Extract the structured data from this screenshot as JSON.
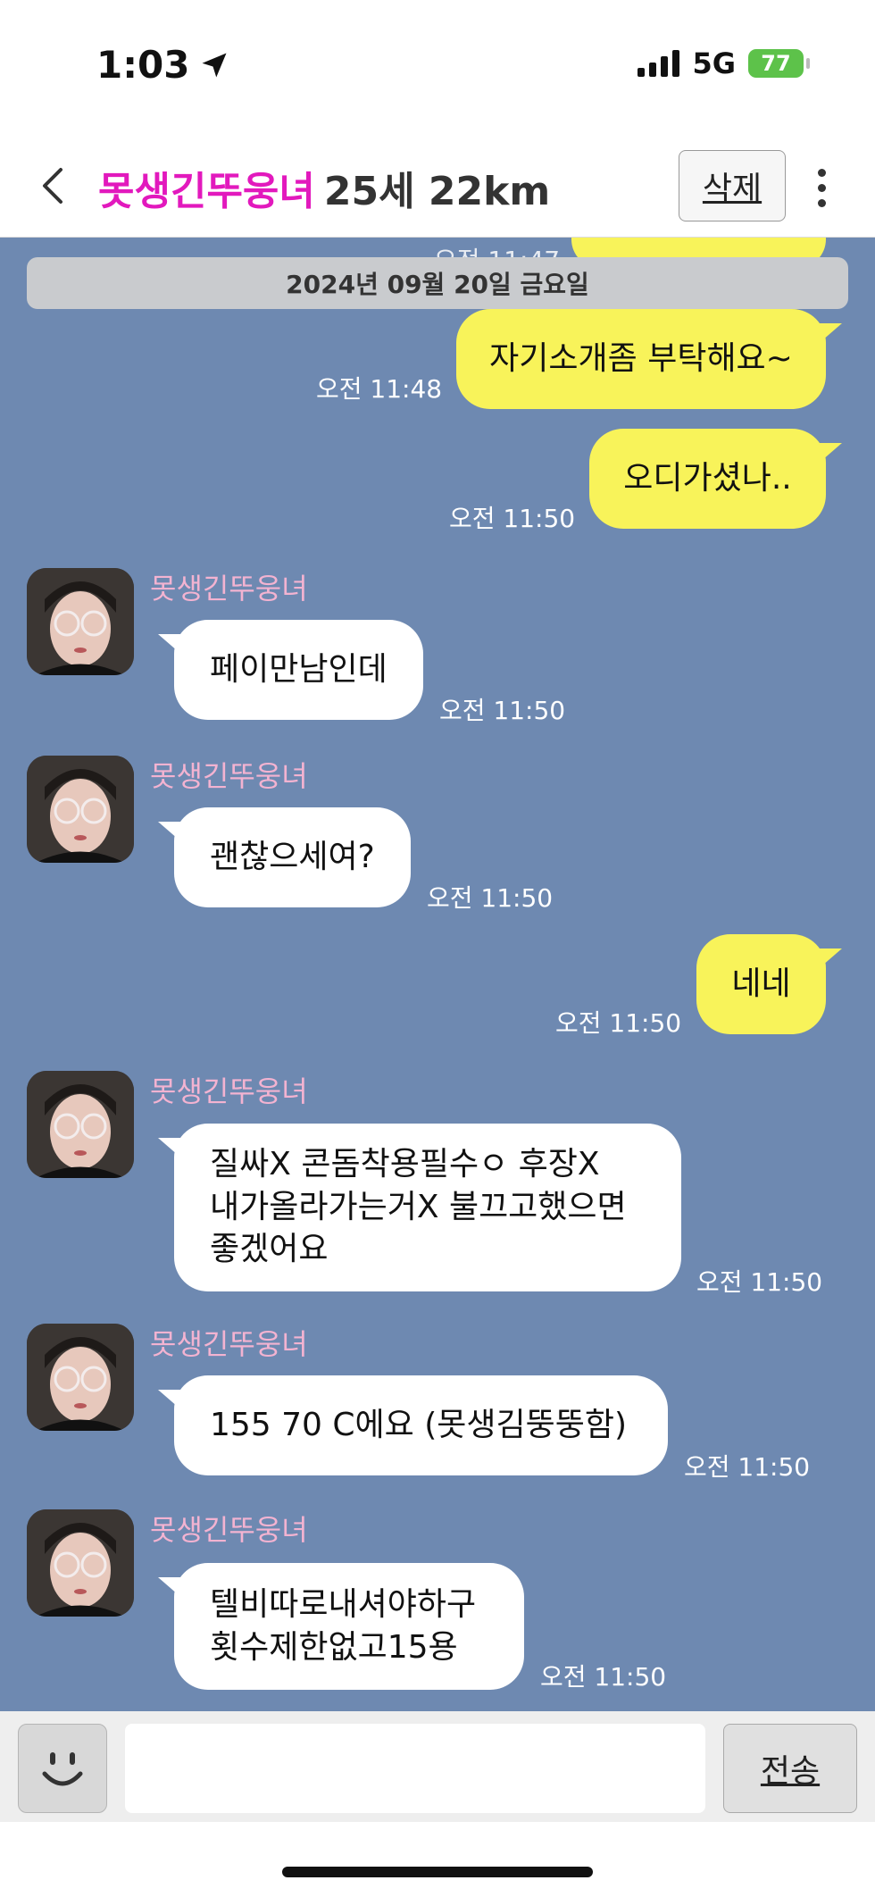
{
  "status_bar": {
    "time": "1:03",
    "network": "5G",
    "battery": "77"
  },
  "header": {
    "contact_name": "못생긴뚜웅녀",
    "meta": "25세 22km",
    "delete_label": "삭제"
  },
  "chat": {
    "date_divider": "2024년 09월 20일 금요일",
    "top_partial_time": "오전 11:47",
    "messages": [
      {
        "from": "me",
        "text": "자기소개좀 부탁해요~",
        "time": "오전 11:48"
      },
      {
        "from": "me",
        "text": "오디가셨나..",
        "time": "오전 11:50"
      },
      {
        "from": "other",
        "sender": "못생긴뚜웅녀",
        "text": "페이만남인데",
        "time": "오전 11:50"
      },
      {
        "from": "other",
        "sender": "못생긴뚜웅녀",
        "text": "괜찮으세여?",
        "time": "오전 11:50"
      },
      {
        "from": "me",
        "text": "네네",
        "time": "오전 11:50"
      },
      {
        "from": "other",
        "sender": "못생긴뚜웅녀",
        "lines": [
          "질싸X 콘돔착용필수ㅇ 후장X",
          "내가올라가는거X 불끄고했으면",
          "좋겠어요"
        ],
        "time": "오전 11:50"
      },
      {
        "from": "other",
        "sender": "못생긴뚜웅녀",
        "text": "155 70 C에요 (못생김뚱뚱함)",
        "time": "오전 11:50"
      },
      {
        "from": "other",
        "sender": "못생긴뚜웅녀",
        "lines": [
          "텔비따로내셔야하구",
          "횟수제한없고15용"
        ],
        "time": "오전 11:50"
      }
    ]
  },
  "input_bar": {
    "placeholder": "",
    "send_label": "전송"
  },
  "icons": {
    "back": "chevron-left-icon",
    "more": "more-vertical-icon",
    "emoji": "smiley-icon",
    "location": "location-arrow-icon"
  },
  "colors": {
    "chat_bg": "#6e89b1",
    "my_bubble": "#f8f35a",
    "name_accent": "#e219bd",
    "sender_name": "#f3b3d1"
  }
}
